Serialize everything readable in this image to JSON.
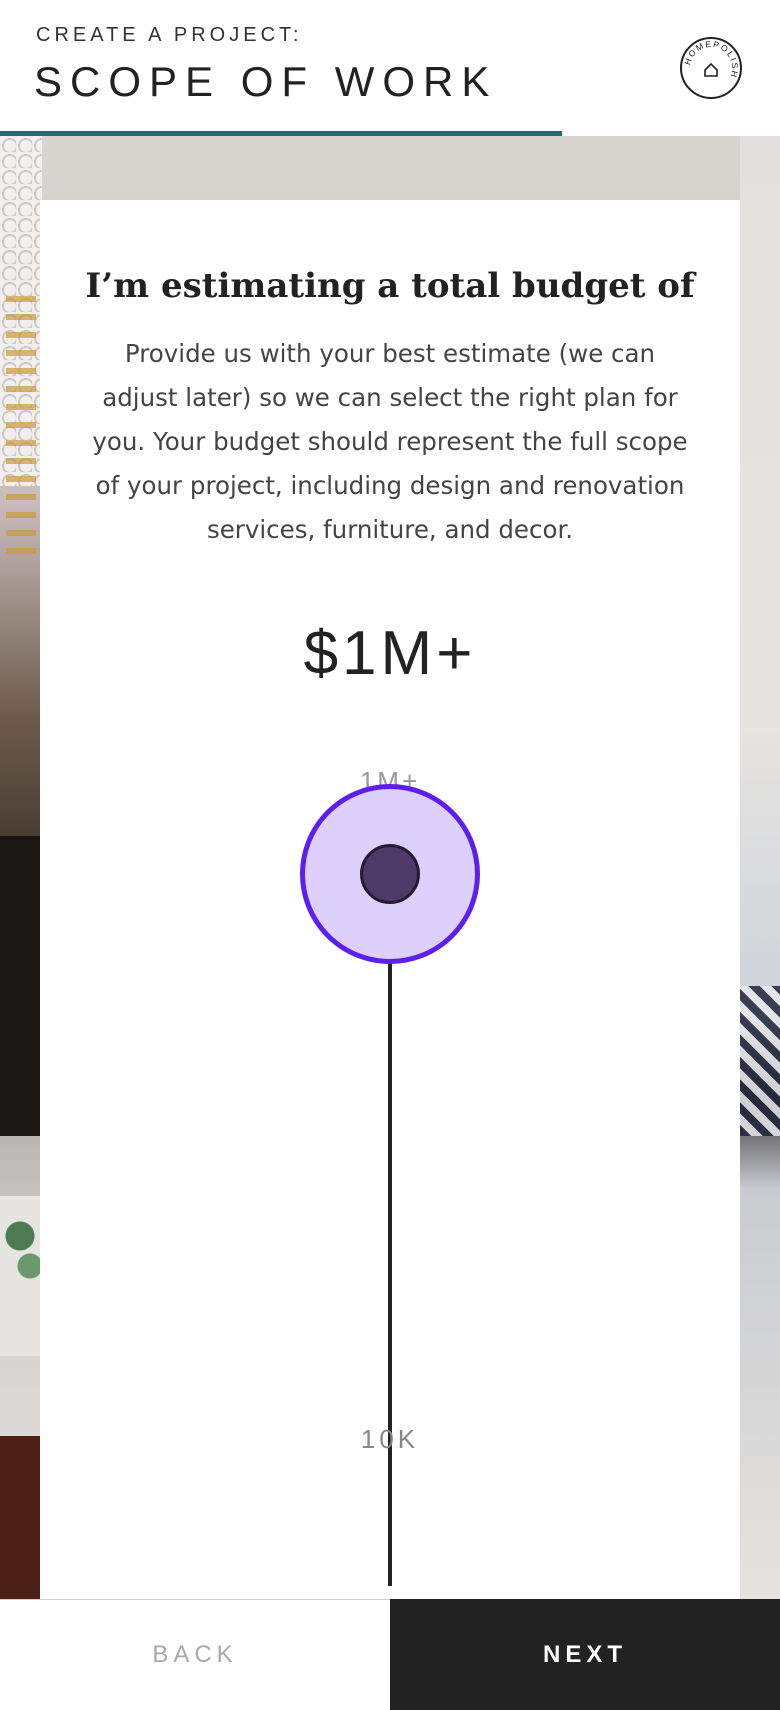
{
  "header": {
    "eyebrow": "CREATE A PROJECT:",
    "title": "SCOPE OF WORK",
    "logo_text": "HOMEPOLISH",
    "progress": 0.72
  },
  "card": {
    "heading": "I’m estimating a total budget of",
    "body": "Provide us with your best estimate (we can adjust later) so we can select the right plan for you. Your budget should represent the full scope of your project, including design and renovation services, furniture, and decor.",
    "amount": "$1M+"
  },
  "slider": {
    "max_label": "1M+",
    "min_label": "10K",
    "value_fraction": 1.0
  },
  "footer": {
    "back_label": "BACK",
    "next_label": "NEXT"
  },
  "colors": {
    "accent": "#1b6f6f",
    "slider_ring": "#5c1ff0",
    "slider_halo": "#ddd0fc",
    "slider_thumb": "#4d3a68",
    "next_bg": "#222222"
  },
  "icons": {
    "logo": "homepolish-logo-icon"
  }
}
